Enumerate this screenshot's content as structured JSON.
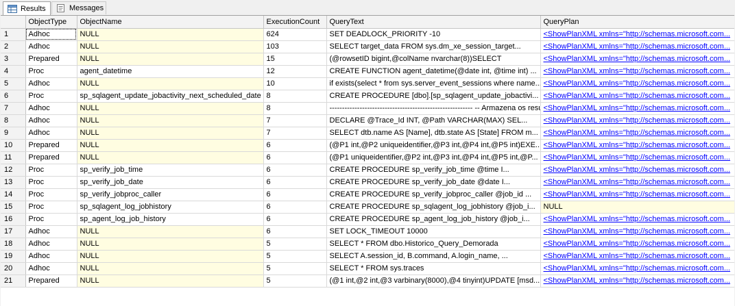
{
  "tabs": [
    {
      "label": "Results",
      "icon": "grid-icon",
      "active": true
    },
    {
      "label": "Messages",
      "icon": "messages-icon",
      "active": false
    }
  ],
  "columns": [
    "",
    "ObjectType",
    "ObjectName",
    "ExecutionCount",
    "QueryText",
    "QueryPlan"
  ],
  "rows": [
    {
      "n": "1",
      "type": "Adhoc",
      "name": "NULL",
      "count": "624",
      "text": "SET DEADLOCK_PRIORITY -10",
      "plan": "<ShowPlanXML xmlns=\"http://schemas.microsoft.com..."
    },
    {
      "n": "2",
      "type": "Adhoc",
      "name": "NULL",
      "count": "103",
      "text": "SELECT target_data             FROM sys.dm_xe_session_target...",
      "plan": "<ShowPlanXML xmlns=\"http://schemas.microsoft.com..."
    },
    {
      "n": "3",
      "type": "Prepared",
      "name": "NULL",
      "count": "15",
      "text": "(@rowsetID bigint,@colName nvarchar(8))SELECT",
      "plan": "<ShowPlanXML xmlns=\"http://schemas.microsoft.com..."
    },
    {
      "n": "4",
      "type": "Proc",
      "name": "agent_datetime",
      "count": "12",
      "text": "  CREATE FUNCTION agent_datetime(@date int, @time int) ...",
      "plan": "<ShowPlanXML xmlns=\"http://schemas.microsoft.com..."
    },
    {
      "n": "5",
      "type": "Adhoc",
      "name": "NULL",
      "count": "10",
      "text": "if exists(select * from sys.server_event_sessions where name...",
      "plan": "<ShowPlanXML xmlns=\"http://schemas.microsoft.com..."
    },
    {
      "n": "6",
      "type": "Proc",
      "name": "sp_sqlagent_update_jobactivity_next_scheduled_date",
      "count": "8",
      "text": "CREATE PROCEDURE [dbo].[sp_sqlagent_update_jobactivi...",
      "plan": "<ShowPlanXML xmlns=\"http://schemas.microsoft.com..."
    },
    {
      "n": "7",
      "type": "Adhoc",
      "name": "NULL",
      "count": "8",
      "text": "  ---------------------------------------------------------  -- Armazena os resulta...",
      "plan": "<ShowPlanXML xmlns=\"http://schemas.microsoft.com..."
    },
    {
      "n": "8",
      "type": "Adhoc",
      "name": "NULL",
      "count": "7",
      "text": "DECLARE @Trace_Id INT, @Path VARCHAR(MAX)     SEL...",
      "plan": "<ShowPlanXML xmlns=\"http://schemas.microsoft.com..."
    },
    {
      "n": "9",
      "type": "Adhoc",
      "name": "NULL",
      "count": "7",
      "text": "SELECT dtb.name AS [Name], dtb.state AS [State] FROM m...",
      "plan": "<ShowPlanXML xmlns=\"http://schemas.microsoft.com..."
    },
    {
      "n": "10",
      "type": "Prepared",
      "name": "NULL",
      "count": "6",
      "text": "(@P1 int,@P2 uniqueidentifier,@P3 int,@P4 int,@P5 int)EXE...",
      "plan": "<ShowPlanXML xmlns=\"http://schemas.microsoft.com..."
    },
    {
      "n": "11",
      "type": "Prepared",
      "name": "NULL",
      "count": "6",
      "text": "(@P1 uniqueidentifier,@P2 int,@P3 int,@P4 int,@P5 int,@P...",
      "plan": "<ShowPlanXML xmlns=\"http://schemas.microsoft.com..."
    },
    {
      "n": "12",
      "type": "Proc",
      "name": "sp_verify_job_time",
      "count": "6",
      "text": "  CREATE PROCEDURE sp_verify_job_time    @time        I...",
      "plan": "<ShowPlanXML xmlns=\"http://schemas.microsoft.com..."
    },
    {
      "n": "13",
      "type": "Proc",
      "name": "sp_verify_job_date",
      "count": "6",
      "text": "CREATE PROCEDURE sp_verify_job_date    @date        I...",
      "plan": "<ShowPlanXML xmlns=\"http://schemas.microsoft.com..."
    },
    {
      "n": "14",
      "type": "Proc",
      "name": "sp_verify_jobproc_caller",
      "count": "6",
      "text": "CREATE PROCEDURE sp_verify_jobproc_caller    @job_id  ...",
      "plan": "<ShowPlanXML xmlns=\"http://schemas.microsoft.com..."
    },
    {
      "n": "15",
      "type": "Proc",
      "name": "sp_sqlagent_log_jobhistory",
      "count": "6",
      "text": "CREATE PROCEDURE sp_sqlagent_log_jobhistory    @job_i...",
      "plan": "NULL"
    },
    {
      "n": "16",
      "type": "Proc",
      "name": "sp_agent_log_job_history",
      "count": "6",
      "text": "CREATE PROCEDURE sp_agent_log_job_history    @job_i...",
      "plan": "<ShowPlanXML xmlns=\"http://schemas.microsoft.com..."
    },
    {
      "n": "17",
      "type": "Adhoc",
      "name": "NULL",
      "count": "6",
      "text": "SET LOCK_TIMEOUT 10000",
      "plan": "<ShowPlanXML xmlns=\"http://schemas.microsoft.com..."
    },
    {
      "n": "18",
      "type": "Adhoc",
      "name": "NULL",
      "count": "5",
      "text": "SELECT *  FROM dbo.Historico_Query_Demorada",
      "plan": "<ShowPlanXML xmlns=\"http://schemas.microsoft.com..."
    },
    {
      "n": "19",
      "type": "Adhoc",
      "name": "NULL",
      "count": "5",
      "text": "SELECT    A.session_id,      B.command,      A.login_name,  ...",
      "plan": "<ShowPlanXML xmlns=\"http://schemas.microsoft.com..."
    },
    {
      "n": "20",
      "type": "Adhoc",
      "name": "NULL",
      "count": "5",
      "text": "SELECT * FROM sys.traces",
      "plan": "<ShowPlanXML xmlns=\"http://schemas.microsoft.com..."
    },
    {
      "n": "21",
      "type": "Prepared",
      "name": "NULL",
      "count": "5",
      "text": "(@1 int,@2 int,@3 varbinary(8000),@4 tinyint)UPDATE [msd...",
      "plan": "<ShowPlanXML xmlns=\"http://schemas.microsoft.com..."
    }
  ]
}
